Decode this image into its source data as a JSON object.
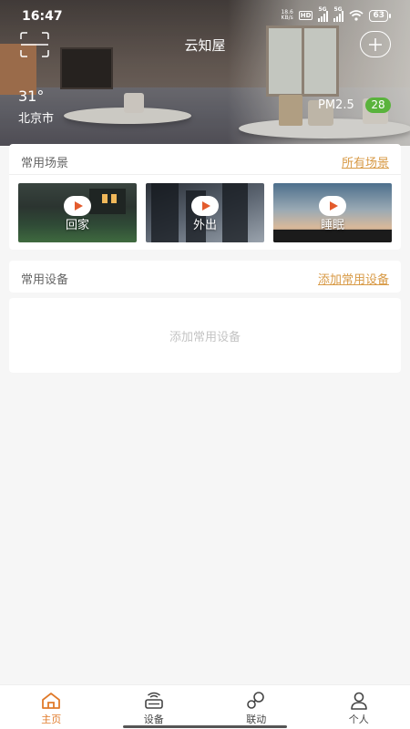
{
  "status_bar": {
    "time": "16:47",
    "net_speed_value": "18.6",
    "net_speed_unit": "KB/s",
    "hd_label": "HD",
    "sim1_label": "5G",
    "sim2_label": "5G",
    "battery": "63"
  },
  "header": {
    "title": "云知屋"
  },
  "weather": {
    "temperature": "31°",
    "city": "北京市",
    "pm_label": "PM2.5",
    "pm_value": "28",
    "pm_color": "#5ab33c"
  },
  "scenes": {
    "title": "常用场景",
    "all_link": "所有场景",
    "items": [
      {
        "label": "回家"
      },
      {
        "label": "外出"
      },
      {
        "label": "睡眠"
      }
    ]
  },
  "devices": {
    "title": "常用设备",
    "add_link": "添加常用设备",
    "empty_text": "添加常用设备"
  },
  "bottom_nav": {
    "items": [
      {
        "label": "主页",
        "icon": "home-icon",
        "active": true
      },
      {
        "label": "设备",
        "icon": "device-icon",
        "active": false
      },
      {
        "label": "联动",
        "icon": "link-icon",
        "active": false
      },
      {
        "label": "个人",
        "icon": "person-icon",
        "active": false
      }
    ],
    "active_color": "#e07a2a"
  },
  "accent_color": "#d89a46"
}
